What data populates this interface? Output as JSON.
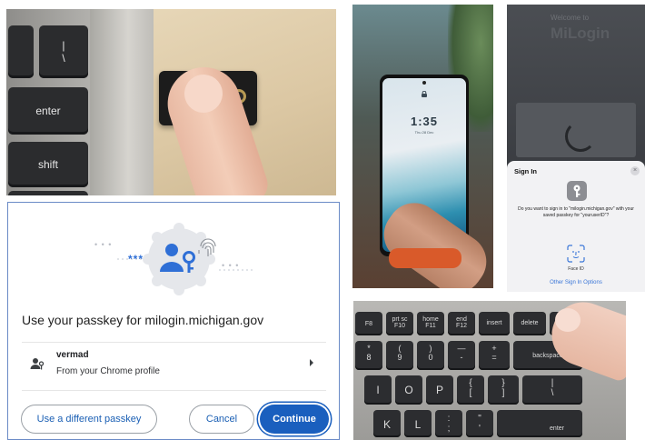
{
  "keyboard_photo": {
    "keys": [
      {
        "label": "|\n\\"
      },
      {
        "label": "enter"
      },
      {
        "label": "shift"
      }
    ]
  },
  "phone_photo": {
    "time": "1:35",
    "date": "Thu 28 Dec"
  },
  "ios_signin": {
    "bg_small": "Welcome to",
    "bg_brand": "MiLogin",
    "title": "Sign In",
    "close": "×",
    "message": "Do you want to sign in to \"milogin.michigan.gov\" with your saved passkey for \"youruserID\"?",
    "face_id": "Face ID",
    "other": "Other Sign In Options"
  },
  "chrome_dialog": {
    "illus_dots_left": "• • •",
    "illus_stars": "***",
    "illus_dots_right": "• • •",
    "title": "Use your passkey for milogin.michigan.gov",
    "account_name": "vermad",
    "account_source": "From your Chrome profile",
    "btn_different": "Use a different passkey",
    "btn_cancel": "Cancel",
    "btn_continue": "Continue",
    "colors": {
      "primary": "#1a5fbe",
      "accent_blue": "#2f6fd6"
    }
  },
  "keyboard_top_photo": {
    "row1": [
      {
        "top": "",
        "bot": "F8"
      },
      {
        "top": "prt sc",
        "bot": "F10"
      },
      {
        "top": "home",
        "bot": "F11"
      },
      {
        "top": "end",
        "bot": "F12"
      },
      {
        "top": "insert",
        "bot": ""
      },
      {
        "top": "delete",
        "bot": ""
      }
    ],
    "row2": [
      {
        "top": "*",
        "bot": "8"
      },
      {
        "top": "(",
        "bot": "9"
      },
      {
        "top": ")",
        "bot": "0"
      },
      {
        "top": "—",
        "bot": "-"
      },
      {
        "top": "+",
        "bot": "="
      },
      {
        "top": "backspace",
        "bot": ""
      }
    ],
    "row3": [
      {
        "top": "I",
        "bot": ""
      },
      {
        "top": "O",
        "bot": ""
      },
      {
        "top": "P",
        "bot": ""
      },
      {
        "top": "{",
        "bot": "["
      },
      {
        "top": "}",
        "bot": "]"
      },
      {
        "top": "|",
        "bot": "\\"
      }
    ],
    "row4": [
      {
        "top": "K",
        "bot": ""
      },
      {
        "top": "L",
        "bot": ""
      },
      {
        "top": ":",
        "bot": ";"
      },
      {
        "top": "\"",
        "bot": "'"
      },
      {
        "top": "enter",
        "bot": ""
      }
    ]
  }
}
